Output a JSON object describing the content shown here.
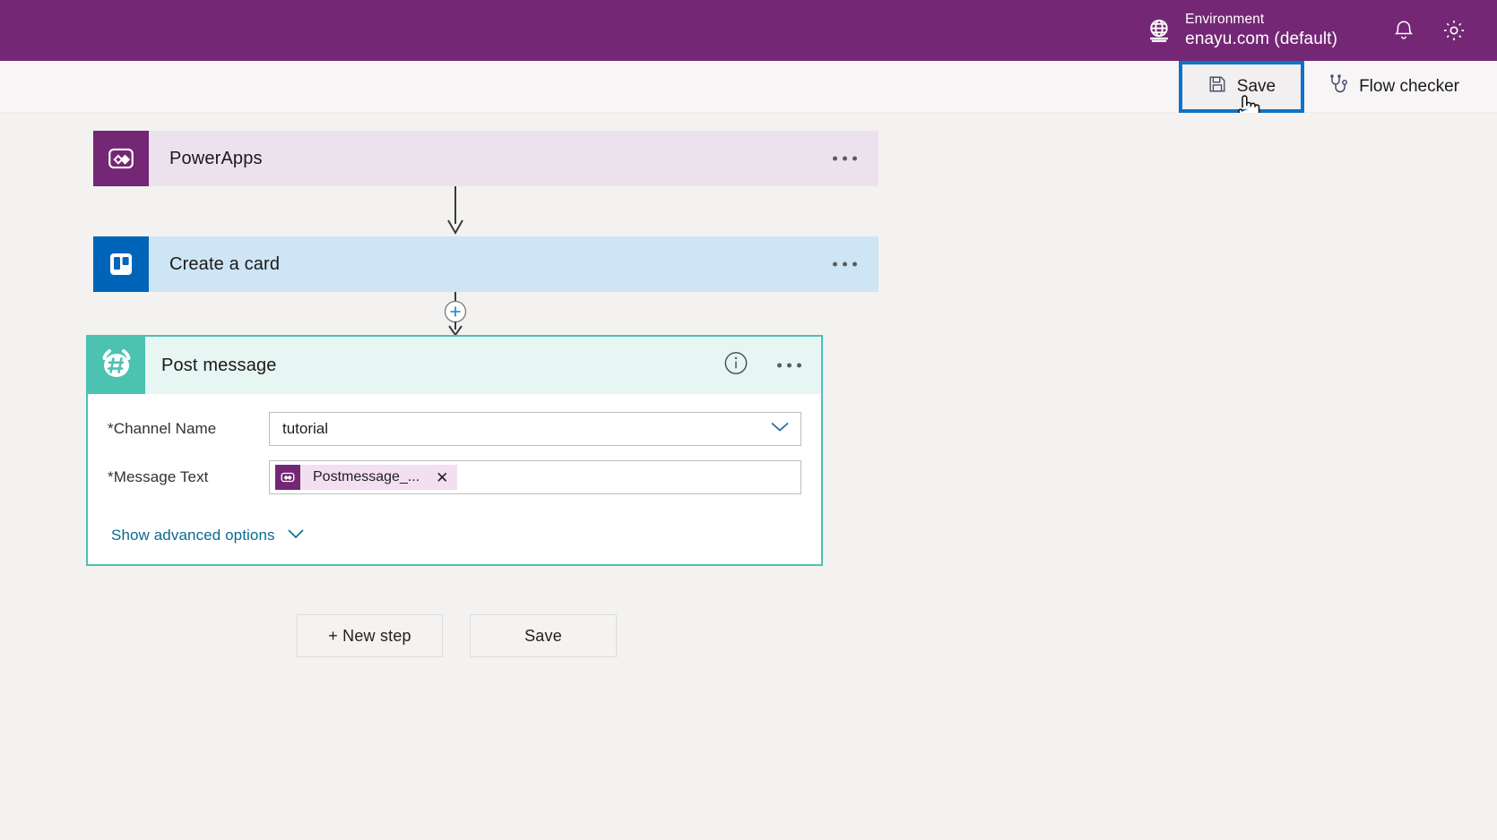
{
  "topbar": {
    "globe_icon": "globe-icon",
    "environment_label": "Environment",
    "environment_value": "enayu.com (default)",
    "notification_icon": "bell-icon",
    "settings_icon": "gear-icon",
    "background_color": "#742774"
  },
  "commandbar": {
    "save_label": "Save",
    "save_icon": "save-disk-icon",
    "flow_checker_label": "Flow checker",
    "flow_checker_icon": "stethoscope-icon",
    "highlight_color": "#0d72c8",
    "cursor": "hand-pointer-cursor"
  },
  "flow": {
    "steps": [
      {
        "id": "powerapps",
        "title": "PowerApps",
        "icon": "powerapps-icon",
        "icon_bg": "#742774",
        "header_bg": "#ece2ee",
        "menu_icon": "ellipsis-icon"
      },
      {
        "id": "trello",
        "title": "Create a card",
        "icon": "trello-icon",
        "icon_bg": "#0065b8",
        "header_bg": "#cee5f5",
        "menu_icon": "ellipsis-icon"
      },
      {
        "id": "postmessage",
        "title": "Post message",
        "icon": "slack-icon",
        "icon_bg": "#4cc2b1",
        "header_bg": "#e7f6f3",
        "border_color": "#4cc2b1",
        "info_icon": "info-icon",
        "menu_icon": "ellipsis-icon"
      }
    ],
    "connectors": [
      {
        "id": "conn-1",
        "type": "arrow"
      },
      {
        "id": "conn-2",
        "type": "insert-arrow",
        "icon": "plus-circle-icon"
      }
    ]
  },
  "postmessage_fields": {
    "channel": {
      "required_mark": "*",
      "label": "Channel Name",
      "value": "tutorial",
      "dropdown_icon": "chevron-down-icon"
    },
    "message": {
      "required_mark": "*",
      "label": "Message Text",
      "token_label": "Postmessage_...",
      "token_icon": "powerapps-icon",
      "token_remove_icon": "close-icon"
    },
    "advanced_options_label": "Show advanced options",
    "advanced_options_icon": "chevron-down-icon"
  },
  "bottom_actions": {
    "new_step_label": "+ New step",
    "save_label": "Save"
  }
}
